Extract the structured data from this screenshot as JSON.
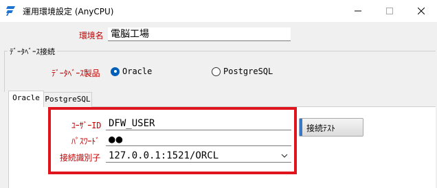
{
  "window": {
    "title": "運用環境設定 (AnyCPU)",
    "icon": "app-logo-icon",
    "controls": [
      "minimize-icon",
      "maximize-icon",
      "close-icon"
    ]
  },
  "environment": {
    "label": "環境名",
    "value": "電脳工場"
  },
  "db_group": {
    "title": "ﾃﾞｰﾀﾍﾞｰｽ接続",
    "product_label": "ﾃﾞｰﾀﾍﾞｰｽ製品",
    "options": [
      {
        "label": "Oracle",
        "selected": true
      },
      {
        "label": "PostgreSQL",
        "selected": false
      }
    ]
  },
  "tabs": [
    {
      "label": "Oracle",
      "active": true
    },
    {
      "label": "PostgreSQL",
      "active": false
    }
  ],
  "oracle": {
    "user_label": "ﾕｰｻﾞｰID",
    "user_value": "DFW_USER",
    "password_label": "ﾊﾟｽﾜｰﾄﾞ",
    "password_value": "●●",
    "connection_label": "接続識別子",
    "connection_value": "127.0.0.1:1521/ORCL",
    "test_button": "接続ﾃｽﾄ"
  },
  "colors": {
    "label_red": "#c00000",
    "highlight_border": "#e0141c",
    "radio_selected": "#005fb8",
    "button_accent": "#3a78c4",
    "logo_blue": "#1e73d2"
  }
}
